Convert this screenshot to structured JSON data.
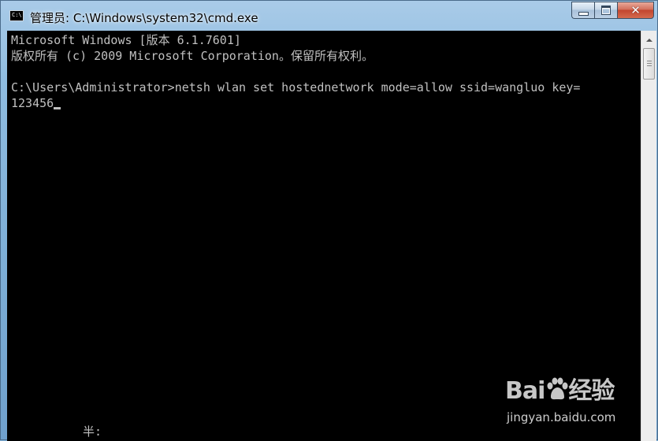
{
  "window": {
    "title": "管理员: C:\\Windows\\system32\\cmd.exe",
    "icon_text": "C:\\",
    "buttons": {
      "minimize": "minimize-icon",
      "maximize": "maximize-icon",
      "close_glyph": "✕"
    }
  },
  "console": {
    "lines": [
      "Microsoft Windows [版本 6.1.7601]",
      "版权所有 (c) 2009 Microsoft Corporation。保留所有权利。",
      "",
      "C:\\Users\\Administrator>netsh wlan set hostednetwork mode=allow ssid=wangluo key=",
      "123456"
    ],
    "ime_status": "半:"
  },
  "watermark": {
    "logo_left": "Bai",
    "logo_right": "经验",
    "url": "jingyan.baidu.com"
  },
  "colors": {
    "console_bg": "#000000",
    "console_fg": "#c0c0c0",
    "close_button": "#c2452e"
  }
}
